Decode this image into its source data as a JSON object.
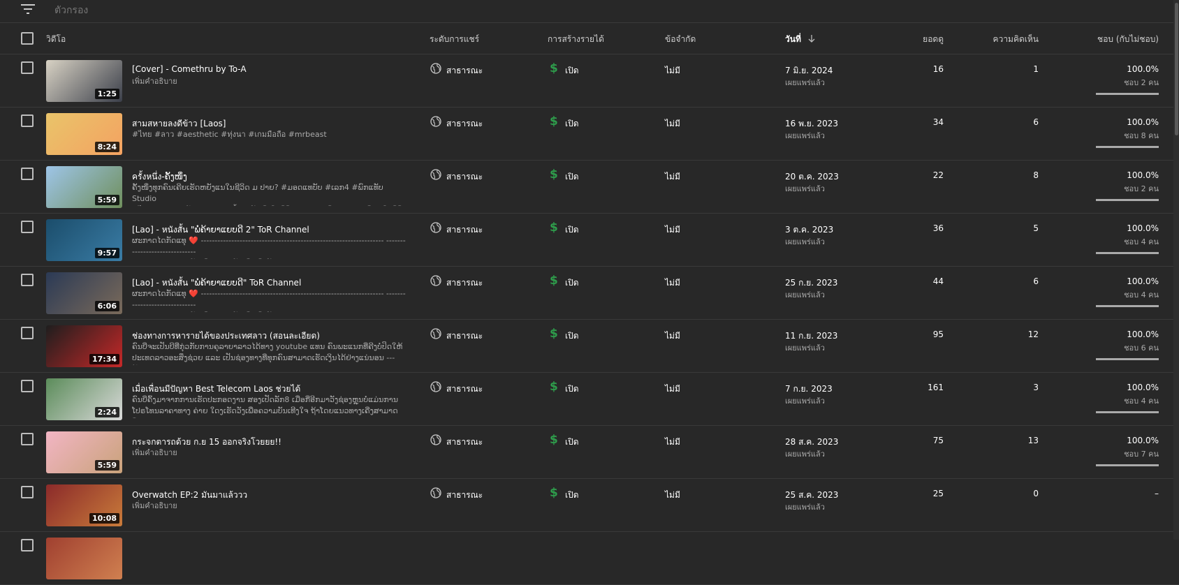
{
  "filter": {
    "placeholder": "ตัวกรอง",
    "icon": "filter-icon"
  },
  "header": {
    "video": "วิดีโอ",
    "visibility": "ระดับการแชร์",
    "monetization": "การสร้างรายได้",
    "restrictions": "ข้อจำกัด",
    "date": "วันที่",
    "views": "ยอดดู",
    "comments": "ความคิดเห็น",
    "likes": "ชอบ (กับไม่ชอบ)"
  },
  "colors": {
    "background": "#282828",
    "monetization_green": "#2e9c4b"
  },
  "rows": [
    {
      "title": "[Cover] - Comethru by To-A",
      "description": "เพิ่มคำอธิบาย",
      "duration": "1:25",
      "visibility": "สาธารณะ",
      "monetization": "เปิด",
      "restrictions": "ไม่มี",
      "date": "7 มิ.ย. 2024",
      "date_status": "เผยแพร่แล้ว",
      "views": "16",
      "comments": "1",
      "likes_pct": "100.0%",
      "likes_count": "ชอบ 2 คน",
      "likes_ratio": 1.0,
      "thumb_colors": [
        "#d8d2c4",
        "#3b3f4a"
      ]
    },
    {
      "title": "สามสหายลงดีข้าว [Laos]",
      "description": "#ไทย #ลาว #aesthetic #ทุ่งนา #เกมมือถือ #mrbeast",
      "duration": "8:24",
      "visibility": "สาธารณะ",
      "monetization": "เปิด",
      "restrictions": "ไม่มี",
      "date": "16 พ.ย. 2023",
      "date_status": "เผยแพร่แล้ว",
      "views": "34",
      "comments": "6",
      "likes_pct": "100.0%",
      "likes_count": "ชอบ 8 คน",
      "likes_ratio": 1.0,
      "thumb_colors": [
        "#e9c46a",
        "#f4a261"
      ]
    },
    {
      "title": "ครั้งหนึ่ง-ຄັ້ງໜຶ່ງ",
      "description": "ຄັ້ງໜຶ່ງທຸກຄົນເຄີຍເຮັດຫຍັງແນໃນຊີວິດ ມ ປາຍ? #ມອດແທບັບ #ເລກ4 #ພົກແທັບ Studio\n#ไทย #ลาว #ໜັງລາວ #หนังสั้น #ຄັ້ງໜຶ່ງໃນຊີວິດ #ม7 ທຸກຄົນລອງຍອມມິງອ ໃນຊີວິດ ...",
      "duration": "5:59",
      "visibility": "สาธารณะ",
      "monetization": "เปิด",
      "restrictions": "ไม่มี",
      "date": "20 ต.ค. 2023",
      "date_status": "เผยแพร่แล้ว",
      "views": "22",
      "comments": "8",
      "likes_pct": "100.0%",
      "likes_count": "ชอบ 2 คน",
      "likes_ratio": 1.0,
      "thumb_colors": [
        "#9ec5e8",
        "#6f8f5c"
      ]
    },
    {
      "title": "[Lao] - หนังสั้น \"ພໍ່ຄ້າຍາແຍບດີ 2\" ToR Channel",
      "description": "ຜະກາດໄດກັດແທຸ ❤️ ------------------------------------------------------------------ ------------------------------\n------------------- ເຮັດເພື່ອຄວາມບັນເທີງເທົ່ານັ້ນ Youtube: ToR Channel #ลาว #ไทย...",
      "duration": "9:57",
      "visibility": "สาธารณะ",
      "monetization": "เปิด",
      "restrictions": "ไม่มี",
      "date": "3 ต.ค. 2023",
      "date_status": "เผยแพร่แล้ว",
      "views": "36",
      "comments": "5",
      "likes_pct": "100.0%",
      "likes_count": "ชอบ 4 คน",
      "likes_ratio": 1.0,
      "thumb_colors": [
        "#1b4d6b",
        "#3a7ca5"
      ]
    },
    {
      "title": "[Lao] - หนังสั้น \"ພໍ່ຄ້າຍາແຍບດີ\" ToR Channel",
      "description": "ຜະກາດໄດກັດແທຸ ❤️ ------------------------------------------------------------------ ------------------------------\n------------------- ເຮັດເພື່ອຄວາມບັນເທີງເທົ່ານັ້ນ Youtube: ToR Channel #ลาว #ไทย...",
      "duration": "6:06",
      "visibility": "สาธารณะ",
      "monetization": "เปิด",
      "restrictions": "ไม่มี",
      "date": "25 ก.ย. 2023",
      "date_status": "เผยแพร่แล้ว",
      "views": "44",
      "comments": "6",
      "likes_pct": "100.0%",
      "likes_count": "ชอบ 4 คน",
      "likes_ratio": 1.0,
      "thumb_colors": [
        "#2b3a55",
        "#7a6a5a"
      ]
    },
    {
      "title": "ช่องทางการหารายได้ของประเทศลาว (สอนละเอียด)",
      "description": "ຄົນບີ່ຈະເປັນບີທີ່ກຸ່ວກັບການຄຸລາຍາລາວໄດ້ທາງ youtube ແທນ ຄົນພະແນກທີ່ຄີງບໍ່ປິດໃຫ້\nປະເທດລາວອະສິ່ງຊ່ວຍ ແລະ ເປັນຊ່ອງທາງທີ່ທຸກຄົນສາມາດເຮັດເງິນໄດ້ຢ່າງແນ່ນອນ --- ສ້າງນາ...",
      "duration": "17:34",
      "visibility": "สาธารณะ",
      "monetization": "เปิด",
      "restrictions": "ไม่มี",
      "date": "11 ก.ย. 2023",
      "date_status": "เผยแพร่แล้ว",
      "views": "95",
      "comments": "12",
      "likes_pct": "100.0%",
      "likes_count": "ชอบ 6 คน",
      "likes_ratio": 1.0,
      "thumb_colors": [
        "#1e1e1e",
        "#c62828"
      ]
    },
    {
      "title": "เมื่อเพื่อนมีปัญหา Best Telecom Laos ช่วยได้",
      "description": "ຄົນບີ່ຄົ້ງມາຈາກການເຮັດປະກອດງານ ສອງເປັດລັກ8 ເມື່ອກີ່ອີກມາວັງຊ່ອງຫຼຸນບໍ່ແມ່ນການ\nໂປຣໂທນລາຄາທາງ ຄ່າຍ ໃດງເຮັດວັງເພື່ອຄວາມບັນເທີງໃຈ ຖ້າໂດຍແນວທາງເຄີ່ງສາມາດຕິດ...",
      "duration": "2:24",
      "visibility": "สาธารณะ",
      "monetization": "เปิด",
      "restrictions": "ไม่มี",
      "date": "7 ก.ย. 2023",
      "date_status": "เผยแพร่แล้ว",
      "views": "161",
      "comments": "3",
      "likes_pct": "100.0%",
      "likes_count": "ชอบ 4 คน",
      "likes_ratio": 1.0,
      "thumb_colors": [
        "#5b8c5a",
        "#d9d9d9"
      ]
    },
    {
      "title": "กระจกตารถด้วย ก.ย 15 ออกจริงโวยยย!!",
      "description": "เพิ่มคำอธิบาย",
      "duration": "5:59",
      "visibility": "สาธารณะ",
      "monetization": "เปิด",
      "restrictions": "ไม่มี",
      "date": "28 ส.ค. 2023",
      "date_status": "เผยแพร่แล้ว",
      "views": "75",
      "comments": "13",
      "likes_pct": "100.0%",
      "likes_count": "ชอบ 7 คน",
      "likes_ratio": 1.0,
      "thumb_colors": [
        "#f2b5c4",
        "#c9a27a"
      ]
    },
    {
      "title": "Overwatch EP:2 มันมาแล้ววว",
      "description": "เพิ่มคำอธิบาย",
      "duration": "10:08",
      "visibility": "สาธารณะ",
      "monetization": "เปิด",
      "restrictions": "ไม่มี",
      "date": "25 ส.ค. 2023",
      "date_status": "เผยแพร่แล้ว",
      "views": "25",
      "comments": "0",
      "likes_pct": "–",
      "likes_count": "",
      "likes_ratio": null,
      "thumb_colors": [
        "#8b2a2a",
        "#c97b3a"
      ]
    }
  ]
}
